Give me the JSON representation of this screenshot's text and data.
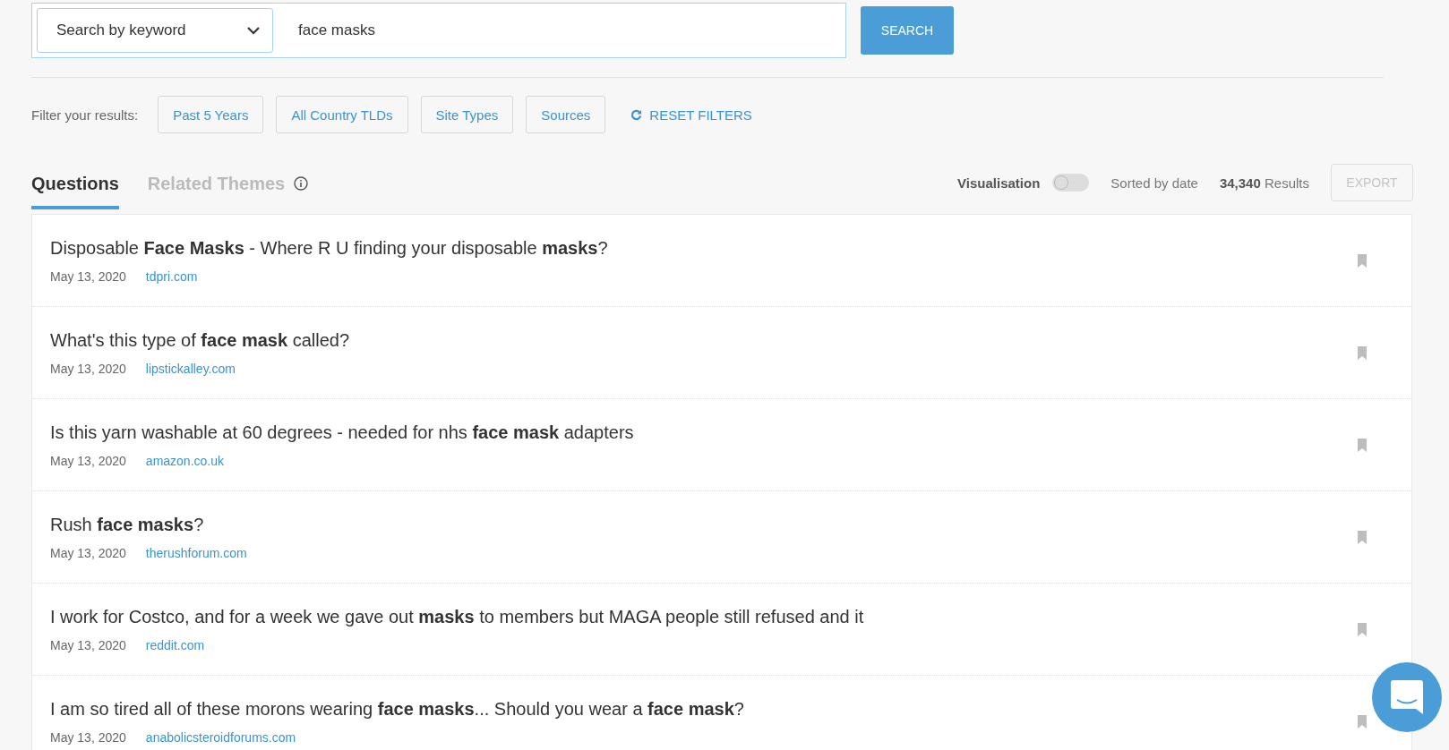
{
  "search": {
    "mode": "Search by keyword",
    "query": "face masks",
    "button": "SEARCH"
  },
  "filters": {
    "label": "Filter your results:",
    "buttons": [
      "Past 5 Years",
      "All Country TLDs",
      "Site Types",
      "Sources"
    ],
    "reset": "RESET FILTERS"
  },
  "tabs": [
    {
      "label": "Questions",
      "selected": true
    },
    {
      "label": "Related Themes",
      "selected": false
    }
  ],
  "toolbar": {
    "visualisation": {
      "label": "Visualisation",
      "on": false
    },
    "sort": "Sorted by date",
    "count": "34,340",
    "count_label": "Results",
    "export": {
      "label": "EXPORT",
      "disabled": true
    }
  },
  "results": [
    {
      "title": "Disposable **Face Masks** - Where R U finding your disposable **masks**?",
      "date": "May 13, 2020",
      "site": "tdpri.com"
    },
    {
      "title": "What's this type of **face mask** called?",
      "date": "May 13, 2020",
      "site": "lipstickalley.com"
    },
    {
      "title": "Is this yarn washable at 60 degrees - needed for nhs **face mask** adapters",
      "date": "May 13, 2020",
      "site": "amazon.co.uk"
    },
    {
      "title": "Rush **face masks**?",
      "date": "May 13, 2020",
      "site": "therushforum.com"
    },
    {
      "title": "I work for Costco, and for a week we gave out **masks** to members but MAGA people still refused and it",
      "date": "May 13, 2020",
      "site": "reddit.com"
    },
    {
      "title": "I am so tired all of these morons wearing **face masks**... Should you wear a **face mask**?",
      "date": "May 13, 2020",
      "site": "anabolicsteroidforums.com"
    }
  ]
}
